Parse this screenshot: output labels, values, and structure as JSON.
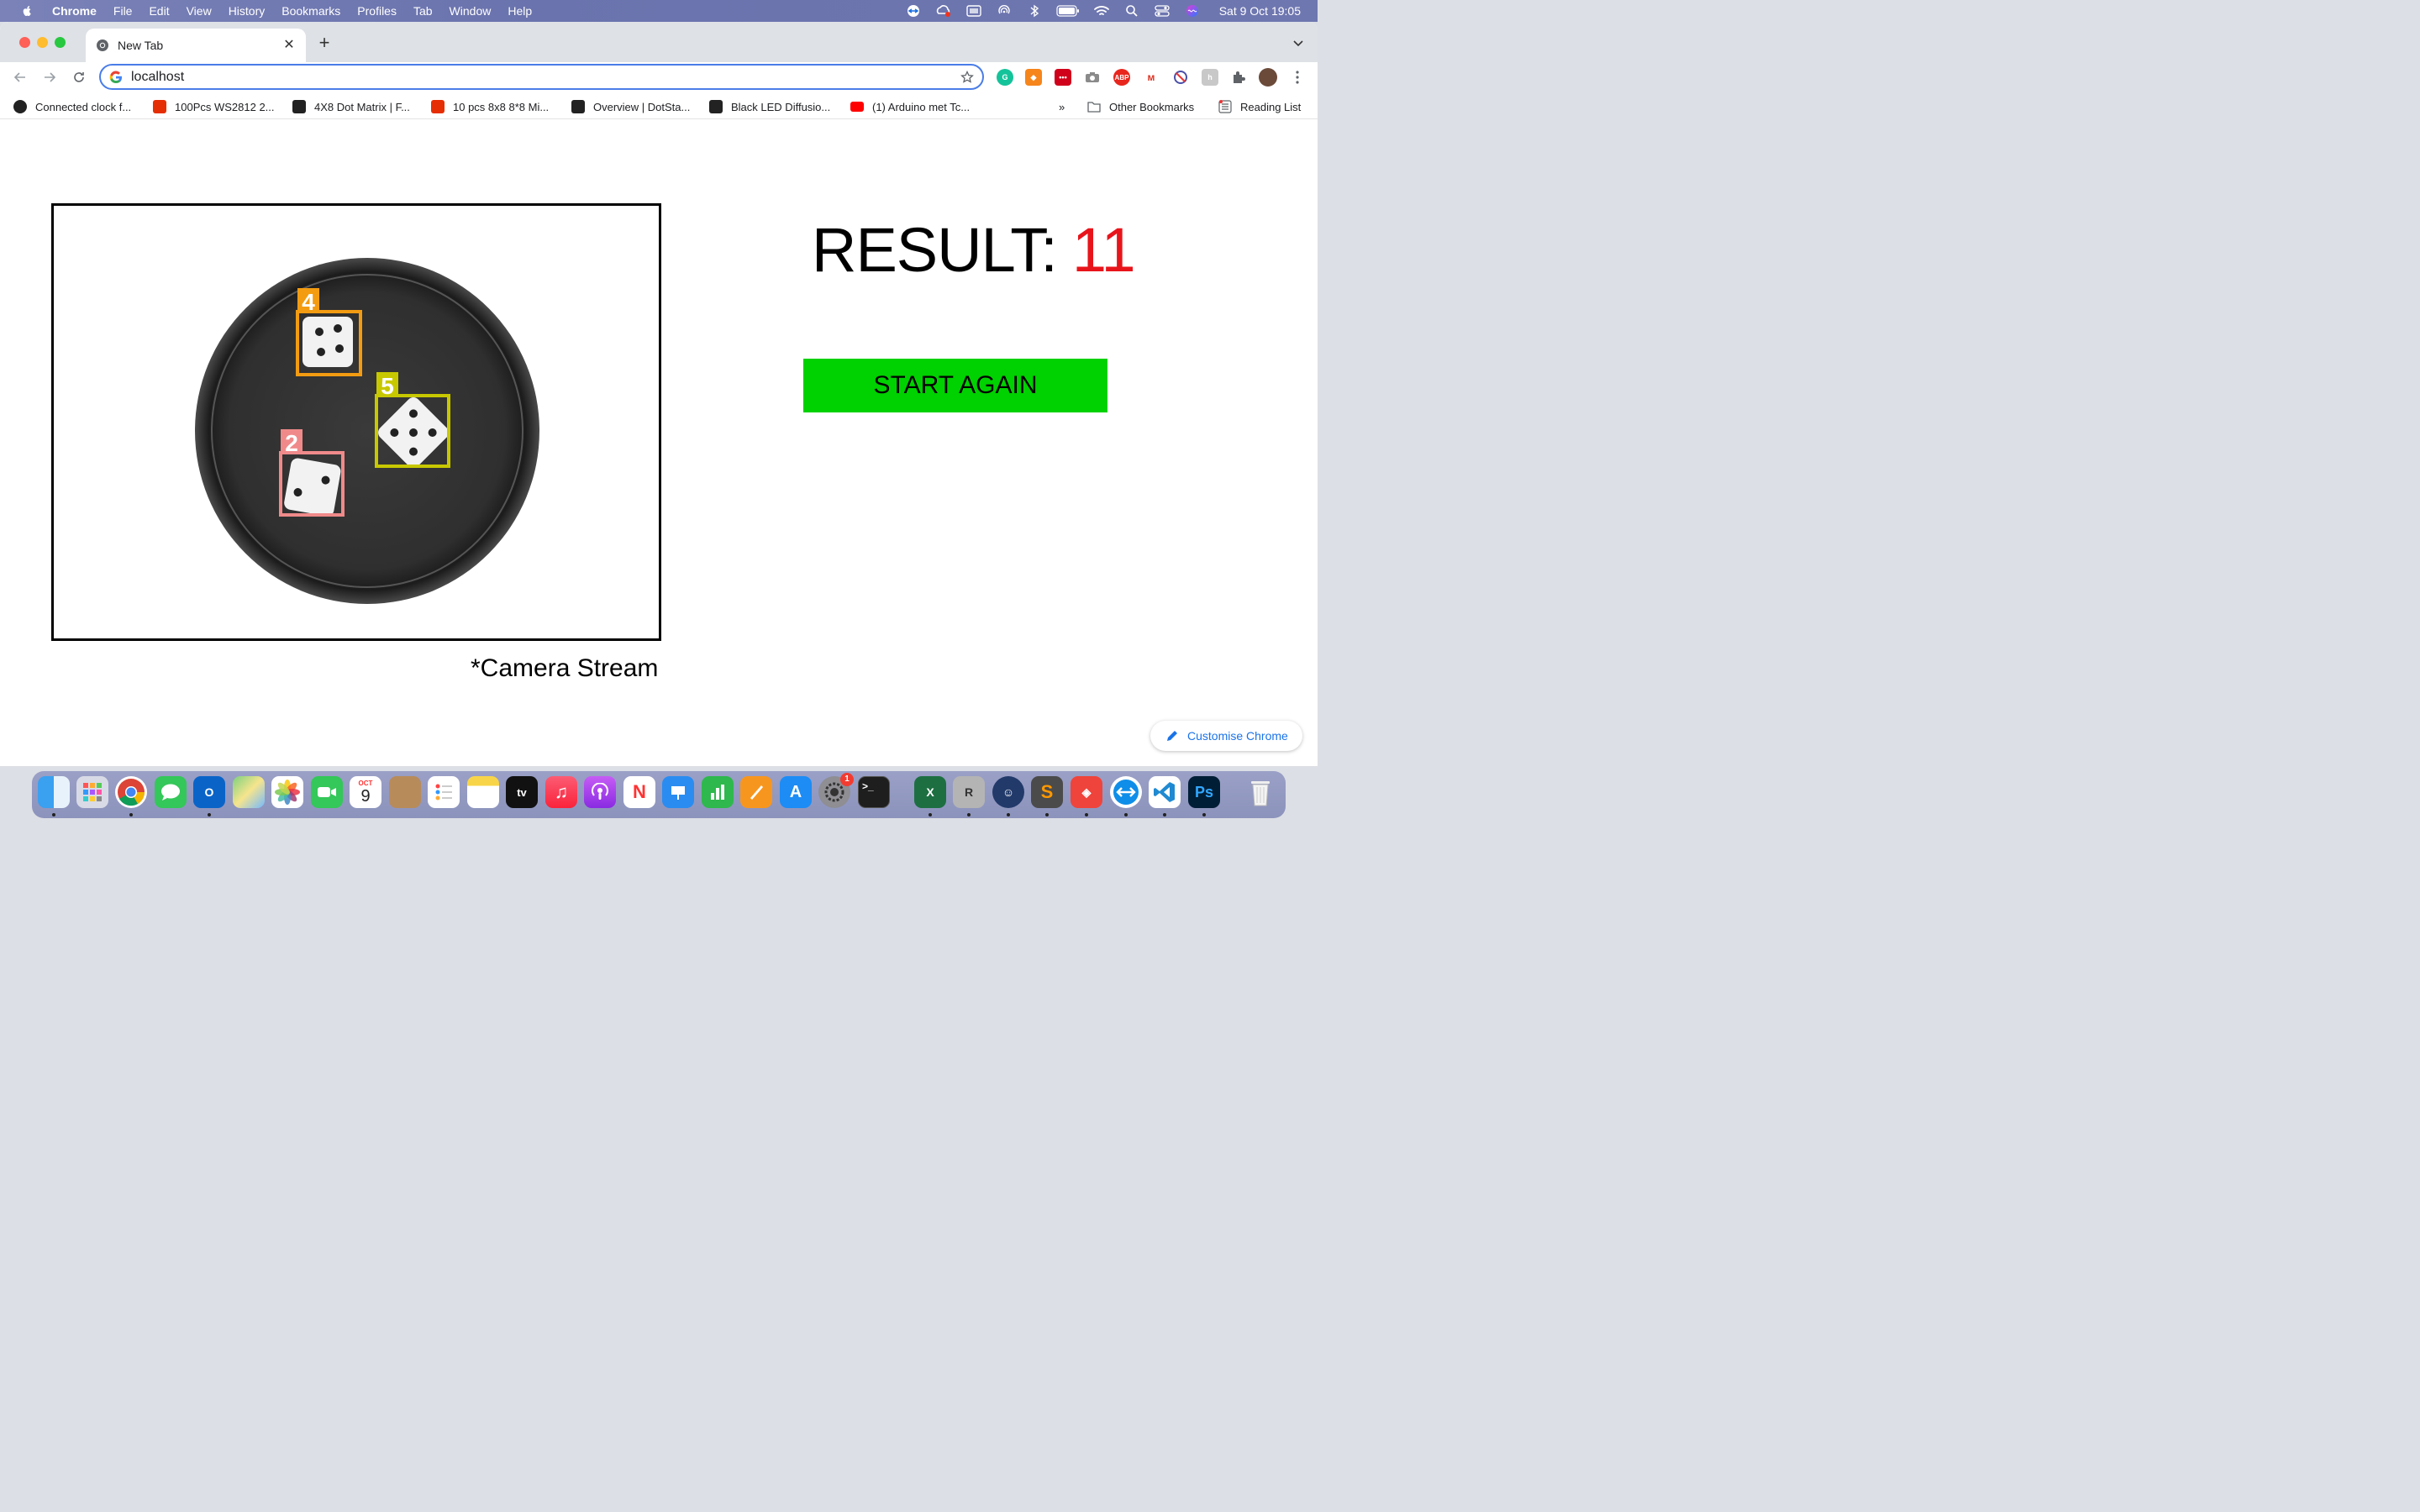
{
  "menubar": {
    "app_name": "Chrome",
    "items": [
      "File",
      "Edit",
      "View",
      "History",
      "Bookmarks",
      "Profiles",
      "Tab",
      "Window",
      "Help"
    ],
    "clock": "Sat 9 Oct  19:05"
  },
  "browser": {
    "tab_title": "New Tab",
    "address": "localhost",
    "bookmarks": [
      {
        "label": "Connected clock f...",
        "icon": "instructables-icon",
        "color": "#222222"
      },
      {
        "label": "100Pcs WS2812 2...",
        "icon": "aliexpress-icon",
        "color": "#e62e04"
      },
      {
        "label": "4X8 Dot Matrix | F...",
        "icon": "fritzing-icon",
        "color": "#222222"
      },
      {
        "label": "10 pcs 8x8 8*8 Mi...",
        "icon": "aliexpress-icon",
        "color": "#e62e04"
      },
      {
        "label": "Overview | DotSta...",
        "icon": "adafruit-icon",
        "color": "#222222"
      },
      {
        "label": "Black LED Diffusio...",
        "icon": "adafruit-icon",
        "color": "#222222"
      },
      {
        "label": "(1) Arduino met Tc...",
        "icon": "youtube-icon",
        "color": "#ff0000"
      }
    ],
    "overflow": "»",
    "other_bookmarks": "Other Bookmarks",
    "reading_list": "Reading List"
  },
  "page": {
    "result_label": "RESULT:",
    "result_value": "11",
    "start_button": "START AGAIN",
    "caption": "*Camera Stream",
    "customise": "Customise Chrome",
    "detections": [
      {
        "label": "4",
        "color": "#f39c12"
      },
      {
        "label": "5",
        "color": "#c8c800"
      },
      {
        "label": "2",
        "color": "#f08a8a"
      }
    ]
  },
  "dock": {
    "calendar_month": "OCT",
    "calendar_day": "9",
    "settings_badge": "1",
    "apps": [
      "finder-icon",
      "launchpad-icon",
      "chrome-icon",
      "messages-icon",
      "outlook-icon",
      "maps-icon",
      "photos-icon",
      "facetime-icon",
      "calendar-icon",
      "contacts-icon",
      "reminders-icon",
      "notes-icon",
      "tv-icon",
      "music-icon",
      "podcasts-icon",
      "news-icon",
      "keynote-icon",
      "numbers-icon",
      "pages-icon",
      "app-store-icon",
      "system-preferences-icon",
      "terminal-icon",
      "excel-icon",
      "rhino-icon",
      "cyberduck-icon",
      "sublime-icon",
      "anydesk-icon",
      "teamviewer-icon",
      "vscode-icon",
      "photoshop-icon",
      "trash-icon"
    ]
  }
}
